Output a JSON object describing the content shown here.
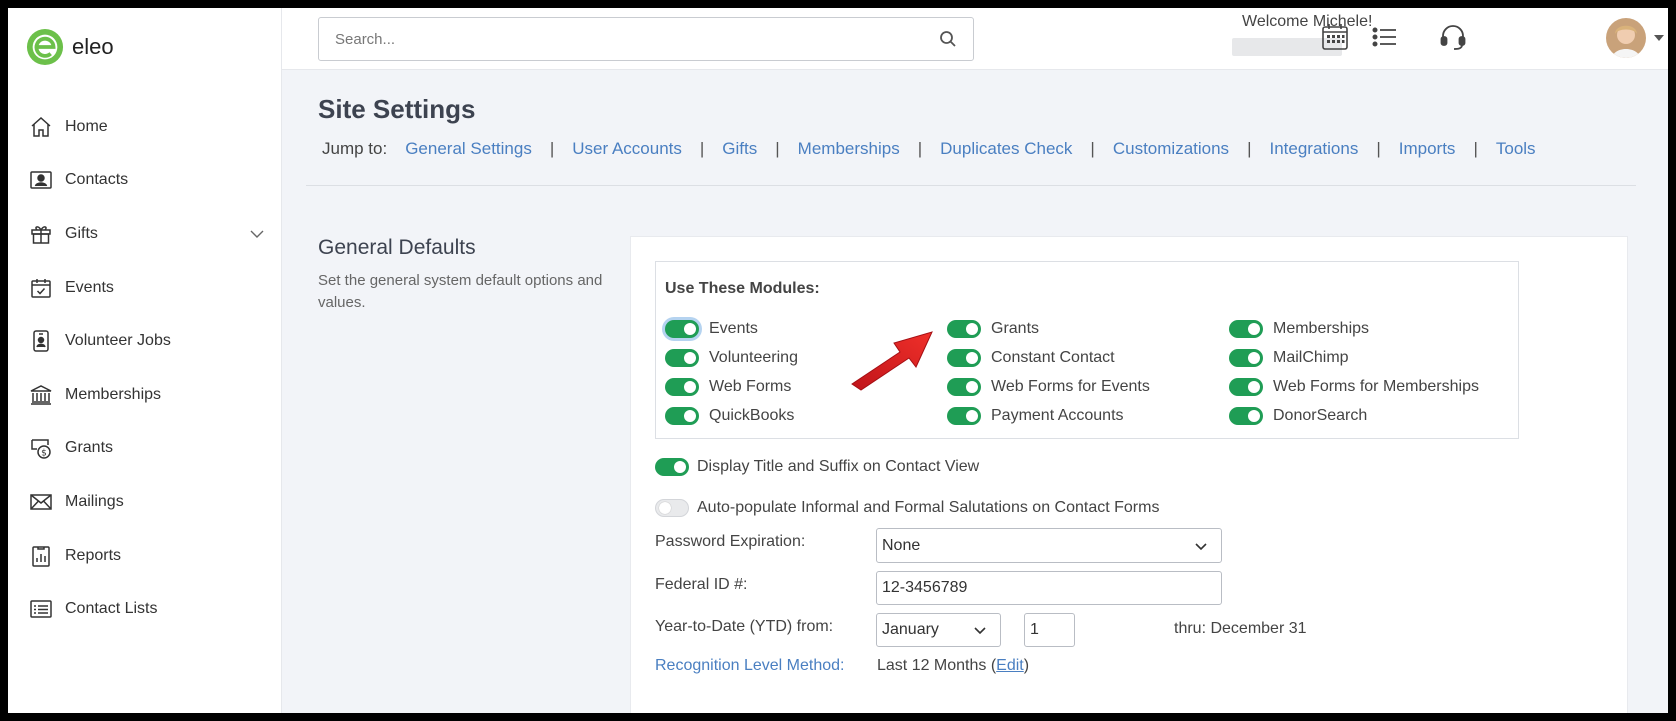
{
  "brand": {
    "name": "eleo",
    "color": "#6cc04a"
  },
  "sidebar": {
    "items": [
      {
        "label": "Home",
        "icon": "home-icon"
      },
      {
        "label": "Contacts",
        "icon": "contact-card-icon"
      },
      {
        "label": "Gifts",
        "icon": "gift-icon",
        "expandable": true
      },
      {
        "label": "Events",
        "icon": "calendar-check-icon"
      },
      {
        "label": "Volunteer Jobs",
        "icon": "badge-icon"
      },
      {
        "label": "Memberships",
        "icon": "institution-icon"
      },
      {
        "label": "Grants",
        "icon": "grant-icon"
      },
      {
        "label": "Mailings",
        "icon": "envelope-icon"
      },
      {
        "label": "Reports",
        "icon": "report-icon"
      },
      {
        "label": "Contact Lists",
        "icon": "list-icon"
      }
    ]
  },
  "topbar": {
    "search_placeholder": "Search...",
    "welcome": "Welcome Michele!"
  },
  "page": {
    "title": "Site Settings",
    "jump_label": "Jump to:",
    "jump_links": [
      "General Settings",
      "User Accounts",
      "Gifts",
      "Memberships",
      "Duplicates Check",
      "Customizations",
      "Integrations",
      "Imports",
      "Tools"
    ]
  },
  "section": {
    "title": "General Defaults",
    "description": "Set the general system default options and values."
  },
  "modules": {
    "title": "Use These Modules:",
    "columns": [
      [
        {
          "label": "Events",
          "on": true
        },
        {
          "label": "Volunteering",
          "on": true
        },
        {
          "label": "Web Forms",
          "on": true
        },
        {
          "label": "QuickBooks",
          "on": true
        }
      ],
      [
        {
          "label": "Grants",
          "on": true
        },
        {
          "label": "Constant Contact",
          "on": true
        },
        {
          "label": "Web Forms for Events",
          "on": true
        },
        {
          "label": "Payment Accounts",
          "on": true
        }
      ],
      [
        {
          "label": "Memberships",
          "on": true
        },
        {
          "label": "MailChimp",
          "on": true
        },
        {
          "label": "Web Forms for Memberships",
          "on": true
        },
        {
          "label": "DonorSearch",
          "on": true
        }
      ]
    ]
  },
  "options": {
    "display_title": {
      "label": "Display Title and Suffix on Contact View",
      "on": true
    },
    "auto_populate": {
      "label": "Auto-populate Informal and Formal Salutations on Contact Forms",
      "on": false
    }
  },
  "fields": {
    "password_label": "Password Expiration:",
    "password_value": "None",
    "federal_label": "Federal ID #:",
    "federal_value": "12-3456789",
    "ytd_label": "Year-to-Date (YTD) from:",
    "ytd_month": "January",
    "ytd_day": "1",
    "thru": "thru: December 31",
    "recognition_label": "Recognition Level Method:",
    "recognition_value": "Last 12 Months (",
    "recognition_edit": "Edit",
    "recognition_close": ")"
  },
  "colors": {
    "toggle_on": "#1f9d55",
    "link": "#4a7fc1",
    "annotation_arrow": "#e8231f"
  }
}
